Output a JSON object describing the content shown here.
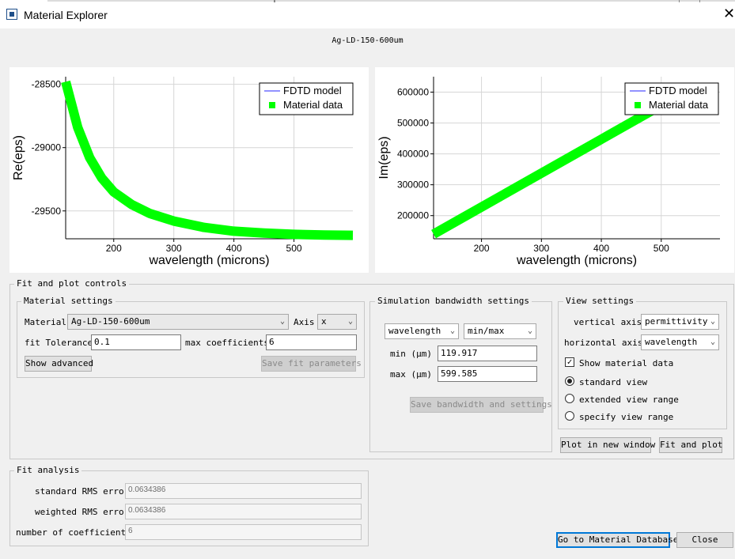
{
  "window": {
    "title": "Material Explorer"
  },
  "plot_title": "Ag-LD-150-600um",
  "chart_data": [
    {
      "type": "line",
      "ylabel": "Re(eps)",
      "xlabel": "wavelength (microns)",
      "xlim": [
        120,
        598
      ],
      "ylim": [
        -29720,
        -28440
      ],
      "xticks": [
        200,
        300,
        400,
        500
      ],
      "yticks": [
        -28500,
        -29000,
        -29500
      ],
      "grid": true,
      "legend_position": "top-right",
      "series": [
        {
          "name": "FDTD model",
          "color": "#5050ff",
          "x": [
            120,
            140,
            160,
            180,
            200,
            230,
            260,
            300,
            350,
            400,
            450,
            500,
            550,
            598
          ],
          "y": [
            -28480,
            -28840,
            -29080,
            -29240,
            -29350,
            -29450,
            -29520,
            -29580,
            -29630,
            -29660,
            -29675,
            -29685,
            -29690,
            -29693
          ]
        },
        {
          "name": "Material data",
          "color": "#00ff00",
          "x": [
            120,
            140,
            160,
            180,
            200,
            230,
            260,
            300,
            350,
            400,
            450,
            500,
            550,
            598
          ],
          "y": [
            -28480,
            -28840,
            -29080,
            -29240,
            -29350,
            -29450,
            -29520,
            -29580,
            -29630,
            -29660,
            -29675,
            -29685,
            -29690,
            -29693
          ]
        }
      ]
    },
    {
      "type": "line",
      "ylabel": "Im(eps)",
      "xlabel": "wavelength (microns)",
      "xlim": [
        120,
        598
      ],
      "ylim": [
        125000,
        650000
      ],
      "xticks": [
        200,
        300,
        400,
        500
      ],
      "yticks": [
        200000,
        300000,
        400000,
        500000,
        600000
      ],
      "grid": true,
      "legend_position": "top-right",
      "series": [
        {
          "name": "FDTD model",
          "color": "#5050ff",
          "x": [
            120,
            530
          ],
          "y": [
            140000,
            590000
          ]
        },
        {
          "name": "Material data",
          "color": "#00ff00",
          "x": [
            120,
            530
          ],
          "y": [
            140000,
            590000
          ]
        }
      ]
    }
  ],
  "fit_plot_controls": {
    "title": "Fit and plot controls",
    "material_settings": {
      "title": "Material settings",
      "material_label": "Material",
      "material_value": "Ag-LD-150-600um",
      "axis_label": "Axis",
      "axis_value": "x",
      "fit_tolerance_label": "fit Tolerance",
      "fit_tolerance_value": "0.1",
      "max_coeff_label": "max coefficients",
      "max_coeff_value": "6",
      "show_advanced": "Show advanced",
      "save_fit": "Save fit parameters"
    },
    "simulation": {
      "title": "Simulation bandwidth settings",
      "unit_value": "wavelength",
      "range_value": "min/max",
      "min_label": "min (μm)",
      "min_value": "119.917",
      "max_label": "max (μm)",
      "max_value": "599.585",
      "save_button": "Save bandwidth and settings"
    },
    "view": {
      "title": "View settings",
      "vertical_label": "vertical axis",
      "vertical_value": "permittivity",
      "horizontal_label": "horizontal axis",
      "horizontal_value": "wavelength",
      "show_data": "Show material data",
      "standard": "standard view",
      "extended": "extended view range",
      "specify": "specify view range"
    },
    "plot_new_window": "Plot in new window",
    "fit_and_plot": "Fit and plot"
  },
  "fit_analysis": {
    "title": "Fit analysis",
    "standard_label": "standard RMS error",
    "standard_value": "0.0634386",
    "weighted_label": "weighted RMS error",
    "weighted_value": "0.0634386",
    "ncoeff_label": "number of coefficients",
    "ncoeff_value": "6"
  },
  "footer": {
    "goto_db": "Go to Material Database",
    "close": "Close"
  }
}
